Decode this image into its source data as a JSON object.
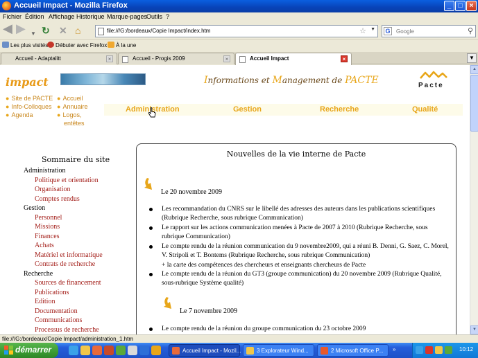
{
  "window": {
    "title": "Accueil Impact - Mozilla Firefox"
  },
  "menu": [
    "Fichier",
    "Édition",
    "Affichage",
    "Historique",
    "Marque-pages",
    "Outils",
    "?"
  ],
  "nav": {
    "url": "file:///G:/bordeaux/Copie Impact/index.htm",
    "search_placeholder": "Google"
  },
  "bookmarks": [
    "Les plus visités",
    "Débuter avec Firefox",
    "À la une"
  ],
  "tabs": [
    {
      "label": "Accueil - Adaptalitt",
      "active": false
    },
    {
      "label": "Accueil - Progis 2009",
      "active": false
    },
    {
      "label": "Accueil Impact",
      "active": true
    }
  ],
  "page": {
    "logo_text": "impact",
    "site_title": {
      "c1": "I",
      "t1": "nformations et ",
      "c2": "M",
      "t2": "anagement de ",
      "c3": "PACTE"
    },
    "pacte_logo_text": "Pacte",
    "quick_links_left": [
      "Site de PACTE",
      "Info-Colloques",
      "Agenda"
    ],
    "quick_links_right": [
      "Accueil",
      "Annuaire",
      "Logos,",
      "entêtes"
    ],
    "top_nav": [
      "Administration",
      "Gestion",
      "Recherche",
      "Qualité"
    ],
    "sidebar": {
      "title": "Sommaire du site",
      "sections": [
        {
          "name": "Administration",
          "items": [
            "Politique et orientation",
            "Organisation",
            "Comptes rendus"
          ]
        },
        {
          "name": "Gestion",
          "items": [
            "Personnel",
            "Missions",
            "Finances",
            "Achats",
            "Matériel et informatique",
            "Contrats de recherche"
          ]
        },
        {
          "name": "Recherche",
          "items": [
            "Sources de financement",
            "Publications",
            "Edition",
            "Documentation",
            "Communications",
            "Processus de recherche"
          ]
        }
      ]
    },
    "news": {
      "heading": "Nouvelles de la vie interne de Pacte",
      "groups": [
        {
          "date": "Le 20 novembre 2009",
          "items": [
            "Les recommandation du CNRS sur le libellé des adresses des auteurs dans les publications scientifiques (Rubrique Recherche, sous rubrique Communication)",
            "Le rapport sur les actions communication menées à Pacte de 2007 à 2010 (Rubrique Recherche, sous rubrique Communication)",
            "Le compte rendu de la réunion communication du 9 novembre2009, qui a réuni B. Denni, G. Saez, C. Morel, V. Stripoli et T. Bontems (Rubrique Recherche, sous rubrique Communication)",
            "+ la carte des compétences des chercheurs et enseignants chercheurs de Pacte",
            "Le compte rendu de la réunion du GT3 (groupe communication) du 20 novembre 2009 (Rubrique Qualité, sous-rubrique Système qualité)"
          ]
        },
        {
          "date": "Le 7 novembre 2009",
          "items": [
            "Le compte rendu de la réunion du groupe communication du 23 octobre 2009"
          ]
        }
      ]
    }
  },
  "status": "file:///G:/bordeaux/Copie Impact/administration_1.htm",
  "taskbar": {
    "start_label": "démarrer",
    "tasks": [
      "Accueil Impact - Mozil...",
      "3 Explorateur Wind...",
      "2 Microsoft Office P..."
    ],
    "clock": "10:12"
  }
}
